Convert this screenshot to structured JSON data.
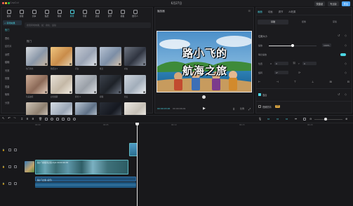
{
  "window": {
    "app_title": "CapCut",
    "doc_title": "6月27日",
    "buttons": [
      "快捷键",
      "专业版",
      "导出"
    ],
    "export_label": "导出",
    "traffic_colors": [
      "#ff5f57",
      "#febc2e",
      "#28c840"
    ]
  },
  "toolbar": {
    "tools": [
      {
        "label": "媒体",
        "active": false
      },
      {
        "label": "音频",
        "active": false
      },
      {
        "label": "文本",
        "active": false
      },
      {
        "label": "贴纸",
        "active": false
      },
      {
        "label": "特效",
        "active": false
      },
      {
        "label": "转场",
        "active": true
      },
      {
        "label": "字幕",
        "active": false
      },
      {
        "label": "滤镜",
        "active": false
      },
      {
        "label": "调节",
        "active": false
      },
      {
        "label": "模板",
        "active": false
      },
      {
        "label": "数字人",
        "active": false
      }
    ]
  },
  "sidebar": {
    "header": "< 转场效果",
    "items": [
      {
        "label": "热门",
        "active": true
      },
      {
        "label": "叠化",
        "active": false
      },
      {
        "label": "幻灯片",
        "active": false
      },
      {
        "label": "运镜",
        "active": false
      },
      {
        "label": "模糊",
        "active": false
      },
      {
        "label": "光效",
        "active": false
      },
      {
        "label": "拍摄",
        "active": false
      },
      {
        "label": "扭曲",
        "active": false
      },
      {
        "label": "故障",
        "active": false
      },
      {
        "label": "分割",
        "active": false
      }
    ]
  },
  "search": {
    "placeholder": "搜索转场效果，如：叠化、运镜"
  },
  "library": {
    "section_label": "热门",
    "tiles": [
      {
        "label": "热门叠化",
        "colors": [
          "#d7dbe0",
          "#8a97a8",
          "#c9b7a3"
        ]
      },
      {
        "label": "撕纸边 II",
        "colors": [
          "#f0c680",
          "#c98c4a",
          "#e6d2b0"
        ]
      },
      {
        "label": "闪白",
        "colors": [
          "#c3c9d3",
          "#9aa4b5",
          "#e1e5ea"
        ]
      },
      {
        "label": "推近",
        "colors": [
          "#b8c4d4",
          "#7c8ea6",
          "#d9c6b0"
        ]
      },
      {
        "label": "向右",
        "colors": [
          "#6e7480",
          "#2f3440",
          "#9098a5"
        ]
      },
      {
        "label": "色差故障",
        "colors": [
          "#d0b09a",
          "#8c6a58",
          "#e6d0c0"
        ]
      },
      {
        "label": "白色烟雾",
        "colors": [
          "#e8e2d8",
          "#c4b8a6",
          "#f4eee4"
        ]
      },
      {
        "label": "叠化 II",
        "colors": [
          "#c8ccd2",
          "#9aa0a8",
          "#e0e2e6"
        ]
      },
      {
        "label": "模糊",
        "colors": [
          "#3c424c",
          "#1e2228",
          "#6a7280"
        ]
      },
      {
        "label": "拉远",
        "colors": [
          "#cfd6de",
          "#a2adba",
          "#eef1f4"
        ]
      },
      {
        "label": "拍摄器",
        "colors": [
          "#cfc4b6",
          "#8e8070",
          "#e8e0d6"
        ]
      },
      {
        "label": "镜像翻转",
        "colors": [
          "#d6dce4",
          "#9aa6b6",
          "#f0f2f5"
        ]
      },
      {
        "label": "放射",
        "colors": [
          "#bcc8d6",
          "#5e7086",
          "#dae2ea"
        ]
      },
      {
        "label": "旋转",
        "colors": [
          "#2a2f38",
          "#151820",
          "#59606c"
        ]
      },
      {
        "label": "故障 II",
        "colors": [
          "#ece8e2",
          "#c6c0b6",
          "#faf8f4"
        ]
      }
    ]
  },
  "player": {
    "title": "播放器",
    "subtitle_line1": "路小飞的",
    "subtitle_line2": "航海之旅",
    "time_current": "00:00:03:26",
    "time_total": "00:00:06:09"
  },
  "inspector": {
    "tabs": [
      {
        "label": "画面",
        "active": true
      },
      {
        "label": "动画",
        "active": false
      },
      {
        "label": "调节",
        "active": false
      },
      {
        "label": "AI效果",
        "active": false
      }
    ],
    "subtabs": [
      {
        "label": "基础",
        "active": true
      },
      {
        "label": "抠像",
        "active": false
      },
      {
        "label": "蒙版",
        "active": false
      }
    ],
    "position_size_label": "位置大小",
    "scale_label": "缩放",
    "scale_value": "100%",
    "scale_fraction": 0.5,
    "uniform_label": "等比缩放",
    "position_label": "位置",
    "x_label": "X",
    "x_value": "0",
    "y_label": "Y",
    "y_value": "0",
    "rotate_label": "旋转",
    "rotate_value": "0°",
    "blend_label": "混合",
    "stabilize_label": "视频防抖",
    "stabilize_badge": "VIP"
  },
  "timeline": {
    "ticks": [
      "00:00",
      "00:05",
      "00:10",
      "00:15",
      "00:20"
    ],
    "main_clip_label": "路小飞的航海之旅.mp4  00:00:06:09",
    "sub_clip_label": "路小飞之旅 (音乐)"
  }
}
